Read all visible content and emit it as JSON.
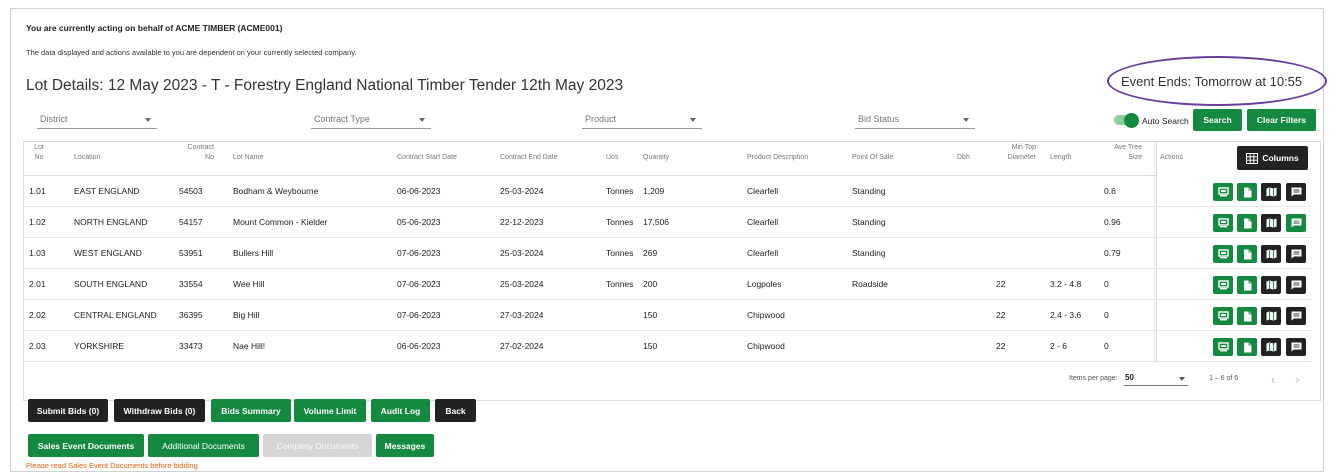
{
  "notice": {
    "acting": "You are currently acting on behalf of ACME TIMBER (ACME001)",
    "info": "The data displayed and actions available to you are dependent on your currently selected company."
  },
  "page": {
    "title": "Lot Details: 12 May 2023 - T - Forestry England National Timber Tender 12th May 2023",
    "event_ends": "Event Ends: Tomorrow at 10:55"
  },
  "filters": {
    "district": "District",
    "contract_type": "Contract Type",
    "product": "Product",
    "bid_status": "Bid Status",
    "auto_search_label": "Auto Search",
    "auto_search_on": true,
    "search": "Search",
    "clear_filters": "Clear Filters"
  },
  "table": {
    "columns_button": "Columns",
    "headers": {
      "lot_no_1": "Lot",
      "lot_no_2": "No",
      "location": "Location",
      "contract_no_1": "Contract",
      "contract_no_2": "No",
      "lot_name": "Lot Name",
      "start": "Contract Start Date",
      "end": "Contract End Date",
      "uos": "Uos",
      "quantity": "Quantity",
      "product": "Product Description",
      "pos": "Point Of Sale",
      "dbh": "Dbh",
      "min_top_1": "Min Top",
      "min_top_2": "Diameter",
      "length": "Length",
      "ave_tree_1": "Ave Tree",
      "ave_tree_2": "Size",
      "actions": "Actions"
    },
    "rows": [
      {
        "lot": "1.01",
        "location": "EAST ENGLAND",
        "contract": "54503",
        "name": "Bodham & Weybourne",
        "start": "06-06-2023",
        "end": "25-03-2024",
        "uos": "Tonnes",
        "qty": "1,209",
        "product": "Clearfell",
        "pos": "Standing",
        "dbh": "",
        "mintop": "",
        "length": "",
        "ave": "0.6",
        "messages_highlight": false
      },
      {
        "lot": "1.02",
        "location": "NORTH ENGLAND",
        "contract": "54157",
        "name": "Mount Common - Kielder",
        "start": "05-06-2023",
        "end": "22-12-2023",
        "uos": "Tonnes",
        "qty": "17,506",
        "product": "Clearfell",
        "pos": "Standing",
        "dbh": "",
        "mintop": "",
        "length": "",
        "ave": "0.96",
        "messages_highlight": true
      },
      {
        "lot": "1.03",
        "location": "WEST ENGLAND",
        "contract": "53951",
        "name": "Bullers Hill",
        "start": "07-06-2023",
        "end": "25-03-2024",
        "uos": "Tonnes",
        "qty": "269",
        "product": "Clearfell",
        "pos": "Standing",
        "dbh": "",
        "mintop": "",
        "length": "",
        "ave": "0.79",
        "messages_highlight": false
      },
      {
        "lot": "2.01",
        "location": "SOUTH ENGLAND",
        "contract": "33554",
        "name": "Wee Hill",
        "start": "07-06-2023",
        "end": "25-03-2024",
        "uos": "Tonnes",
        "qty": "200",
        "product": "Logpoles",
        "pos": "Roadside",
        "dbh": "",
        "mintop": "22",
        "length": "3.2 - 4.8",
        "ave": "0",
        "messages_highlight": false
      },
      {
        "lot": "2.02",
        "location": "CENTRAL ENGLAND",
        "contract": "36395",
        "name": "Big Hill",
        "start": "07-06-2023",
        "end": "27-03-2024",
        "uos": "",
        "qty": "150",
        "product": "Chipwood",
        "pos": "",
        "dbh": "",
        "mintop": "22",
        "length": "2.4 - 3.6",
        "ave": "0",
        "messages_highlight": false
      },
      {
        "lot": "2.03",
        "location": "YORKSHIRE",
        "contract": "33473",
        "name": "Nae Hill!",
        "start": "06-06-2023",
        "end": "27-02-2024",
        "uos": "",
        "qty": "150",
        "product": "Chipwood",
        "pos": "",
        "dbh": "",
        "mintop": "22",
        "length": "2 - 6",
        "ave": "0",
        "messages_highlight": false
      }
    ],
    "pager": {
      "items_per_page_label": "Items per page:",
      "items_per_page": "50",
      "range": "1 – 6 of 6"
    }
  },
  "actions": {
    "submit_bids": "Submit Bids (0)",
    "withdraw_bids": "Withdraw Bids (0)",
    "bids_summary": "Bids Summary",
    "volume_limit": "Volume Limit",
    "audit_log": "Audit Log",
    "back": "Back",
    "sales_event_documents": "Sales Event Documents",
    "additional_documents": "Additional Documents",
    "company_documents": "Company Documents",
    "messages": "Messages",
    "warning": "Please read Sales Event Documents before bidding"
  },
  "colors": {
    "primary_green": "#138a3f",
    "dark": "#222222",
    "disabled": "#d6d6d6",
    "warning": "#e8600c",
    "highlight_oval": "#6a3d99"
  },
  "icons": [
    "monitor-icon",
    "document-icon",
    "map-icon",
    "message-icon",
    "grid-icon",
    "chevron-left-icon",
    "chevron-right-icon"
  ]
}
